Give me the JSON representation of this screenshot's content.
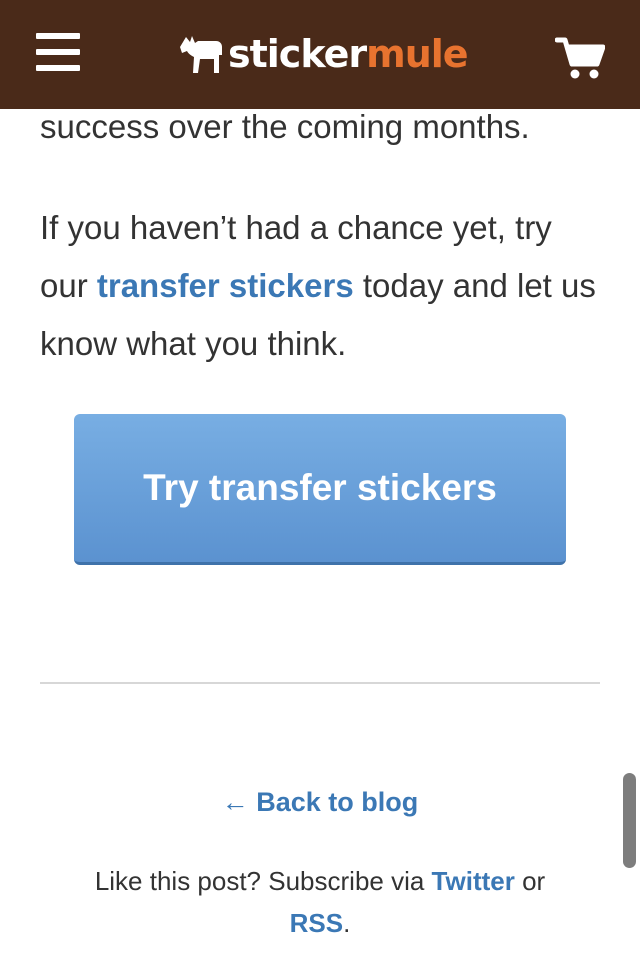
{
  "header": {
    "logo_sticker": "sticker",
    "logo_mule": "mule",
    "menu_icon": "hamburger-menu-icon",
    "cart_icon": "shopping-cart-icon",
    "background_color": "#4a2a19",
    "accent_color": "#e8732f"
  },
  "article": {
    "para1": "success over the coming months.",
    "para2_before": "If you haven’t had a chance yet, try our ",
    "para2_link": "transfer stickers",
    "para2_after": " today and let us know what you think."
  },
  "cta": {
    "label": "Try transfer stickers",
    "color": "#6aa1dc"
  },
  "footer": {
    "back_link": "← Back to blog",
    "subscribe_prefix": "Like this post? Subscribe via ",
    "twitter_link": "Twitter",
    "or_text": " or ",
    "rss_link": "RSS",
    "period": "."
  },
  "link_color": "#3b78b5"
}
